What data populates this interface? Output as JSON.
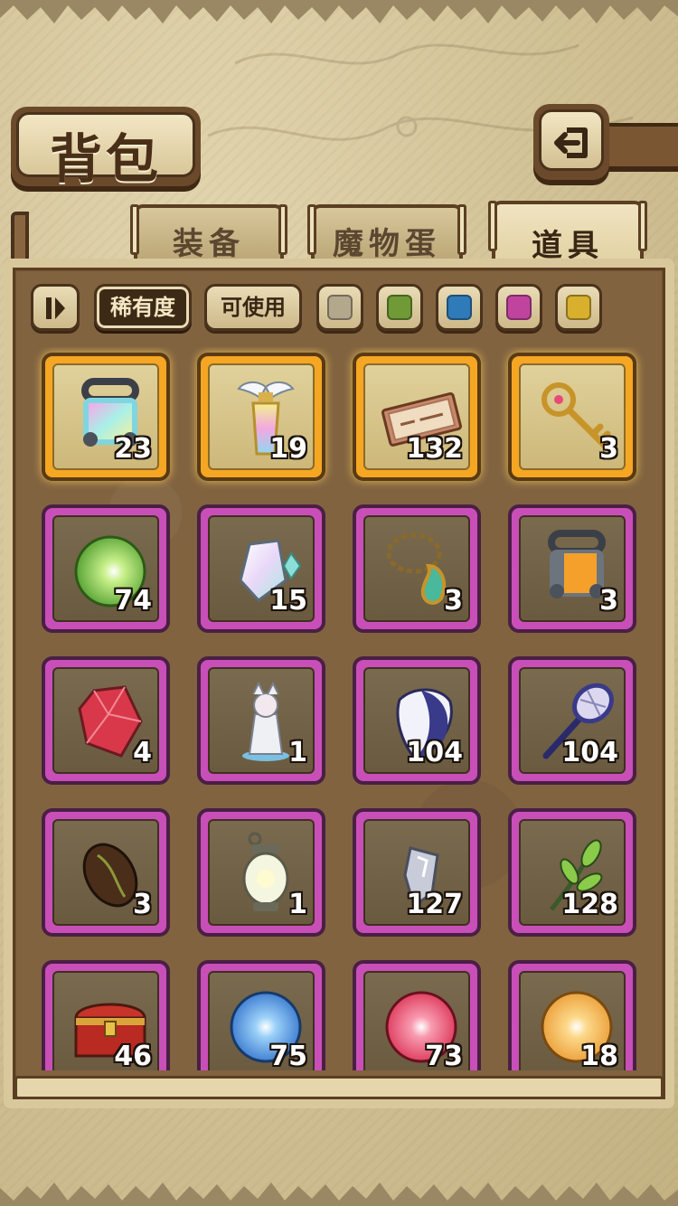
{
  "header": {
    "title": "背包",
    "back_icon": "return-arrow-icon"
  },
  "tabs": [
    {
      "label": "装备",
      "active": false
    },
    {
      "label": "魔物蛋",
      "active": false
    },
    {
      "label": "道具",
      "active": true
    }
  ],
  "filters": {
    "sort_icon": "sort-toggle-icon",
    "rarity_label": "稀有度",
    "usable_label": "可使用",
    "color_chips": [
      {
        "name": "gray",
        "color": "#b3a78c"
      },
      {
        "name": "green",
        "color": "#6f9a35"
      },
      {
        "name": "blue",
        "color": "#2f7ab8"
      },
      {
        "name": "pink",
        "color": "#c0449e"
      },
      {
        "name": "gold",
        "color": "#d8b02e"
      }
    ]
  },
  "colors": {
    "rarity_orange": "#f5a623",
    "rarity_purple": "#c94fb8"
  },
  "items": [
    {
      "icon": "rainbow-lantern-capsule-icon",
      "count": "23",
      "rarity": "orange"
    },
    {
      "icon": "winged-rainbow-bottle-icon",
      "count": "19",
      "rarity": "orange"
    },
    {
      "icon": "ticket-icon",
      "count": "132",
      "rarity": "orange"
    },
    {
      "icon": "golden-key-icon",
      "count": "3",
      "rarity": "orange"
    },
    {
      "icon": "green-orb-icon",
      "count": "74",
      "rarity": "purple"
    },
    {
      "icon": "prism-crystal-icon",
      "count": "15",
      "rarity": "purple"
    },
    {
      "icon": "flower-necklace-icon",
      "count": "3",
      "rarity": "purple"
    },
    {
      "icon": "orange-lantern-capsule-icon",
      "count": "3",
      "rarity": "purple"
    },
    {
      "icon": "red-gem-icon",
      "count": "4",
      "rarity": "purple"
    },
    {
      "icon": "white-figurine-icon",
      "count": "1",
      "rarity": "purple"
    },
    {
      "icon": "moon-mask-icon",
      "count": "104",
      "rarity": "purple"
    },
    {
      "icon": "bug-net-icon",
      "count": "104",
      "rarity": "purple"
    },
    {
      "icon": "brown-seed-icon",
      "count": "3",
      "rarity": "purple"
    },
    {
      "icon": "glowing-lantern-icon",
      "count": "1",
      "rarity": "purple"
    },
    {
      "icon": "crystal-shard-icon",
      "count": "127",
      "rarity": "purple"
    },
    {
      "icon": "green-sprout-icon",
      "count": "128",
      "rarity": "purple"
    },
    {
      "icon": "treasure-chest-icon",
      "count": "46",
      "rarity": "purple"
    },
    {
      "icon": "blue-orb-icon",
      "count": "75",
      "rarity": "purple"
    },
    {
      "icon": "red-orb-icon",
      "count": "73",
      "rarity": "purple"
    },
    {
      "icon": "orange-orb-icon",
      "count": "18",
      "rarity": "purple"
    }
  ]
}
